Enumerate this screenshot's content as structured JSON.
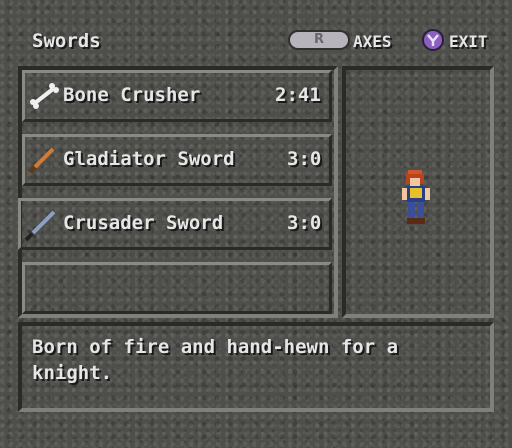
{
  "header": {
    "title": "Swords",
    "r_button": "R",
    "r_action": "AXES",
    "y_action": "EXIT"
  },
  "items": [
    {
      "name": "Bone Crusher",
      "stat": "2:41",
      "icon": "bone-icon"
    },
    {
      "name": "Gladiator Sword",
      "stat": "3:0",
      "icon": "sword-icon"
    },
    {
      "name": "Crusader Sword",
      "stat": "3:0",
      "icon": "sword-icon"
    }
  ],
  "description": {
    "line1": "Born of fire and hand-hewn for a",
    "line2": "knight."
  }
}
